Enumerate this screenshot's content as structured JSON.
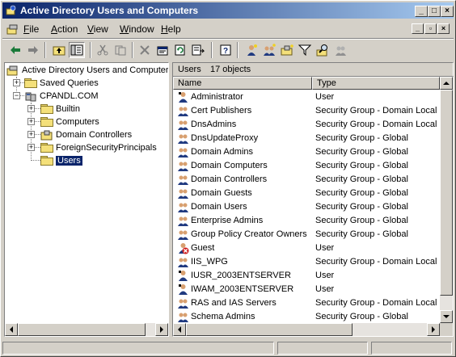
{
  "window": {
    "title": "Active Directory Users and Computers",
    "controls": [
      "_",
      "□",
      "×"
    ]
  },
  "menubar": {
    "items": [
      {
        "label": "File",
        "u": "F",
        "rest": "ile"
      },
      {
        "label": "Action",
        "u": "A",
        "rest": "ction"
      },
      {
        "label": "View",
        "u": "V",
        "rest": "iew"
      },
      {
        "label": "Window",
        "u": "W",
        "rest": "indow"
      },
      {
        "label": "Help",
        "u": "H",
        "rest": "elp"
      }
    ]
  },
  "toolbar": {
    "icons": [
      "back-icon",
      "forward-icon",
      "up-folder-icon",
      "show-hide-tree-icon",
      "cut-icon",
      "copy-icon",
      "delete-icon",
      "properties-icon",
      "refresh-icon",
      "export-list-icon",
      "help-icon",
      "create-user-icon",
      "create-group-icon",
      "create-ou-icon",
      "filter-icon",
      "find-icon",
      "add-to-group-icon"
    ]
  },
  "tree": {
    "root": "Active Directory Users and Computer",
    "saved_queries": "Saved Queries",
    "domain": "CPANDL.COM",
    "children": [
      {
        "label": "Builtin"
      },
      {
        "label": "Computers"
      },
      {
        "label": "Domain Controllers"
      },
      {
        "label": "ForeignSecurityPrincipals"
      },
      {
        "label": "Users",
        "selected": true
      }
    ]
  },
  "list": {
    "header_title": "Users",
    "header_count": "17 objects",
    "columns": [
      "Name",
      "Type"
    ],
    "rows": [
      {
        "name": "Administrator",
        "type": "User",
        "icon": "user"
      },
      {
        "name": "Cert Publishers",
        "type": "Security Group - Domain Local",
        "icon": "group"
      },
      {
        "name": "DnsAdmins",
        "type": "Security Group - Domain Local",
        "icon": "group"
      },
      {
        "name": "DnsUpdateProxy",
        "type": "Security Group - Global",
        "icon": "group"
      },
      {
        "name": "Domain Admins",
        "type": "Security Group - Global",
        "icon": "group"
      },
      {
        "name": "Domain Computers",
        "type": "Security Group - Global",
        "icon": "group"
      },
      {
        "name": "Domain Controllers",
        "type": "Security Group - Global",
        "icon": "group"
      },
      {
        "name": "Domain Guests",
        "type": "Security Group - Global",
        "icon": "group"
      },
      {
        "name": "Domain Users",
        "type": "Security Group - Global",
        "icon": "group"
      },
      {
        "name": "Enterprise Admins",
        "type": "Security Group - Global",
        "icon": "group"
      },
      {
        "name": "Group Policy Creator Owners",
        "type": "Security Group - Global",
        "icon": "group"
      },
      {
        "name": "Guest",
        "type": "User",
        "icon": "disabled-user"
      },
      {
        "name": "IIS_WPG",
        "type": "Security Group - Domain Local",
        "icon": "group"
      },
      {
        "name": "IUSR_2003ENTSERVER",
        "type": "User",
        "icon": "user"
      },
      {
        "name": "IWAM_2003ENTSERVER",
        "type": "User",
        "icon": "user"
      },
      {
        "name": "RAS and IAS Servers",
        "type": "Security Group - Domain Local",
        "icon": "group"
      },
      {
        "name": "Schema Admins",
        "type": "Security Group - Global",
        "icon": "group"
      }
    ]
  },
  "colors": {
    "title_start": "#0a246a",
    "title_end": "#a6caf0",
    "selection": "#0a246a",
    "face": "#d4d0c8"
  }
}
